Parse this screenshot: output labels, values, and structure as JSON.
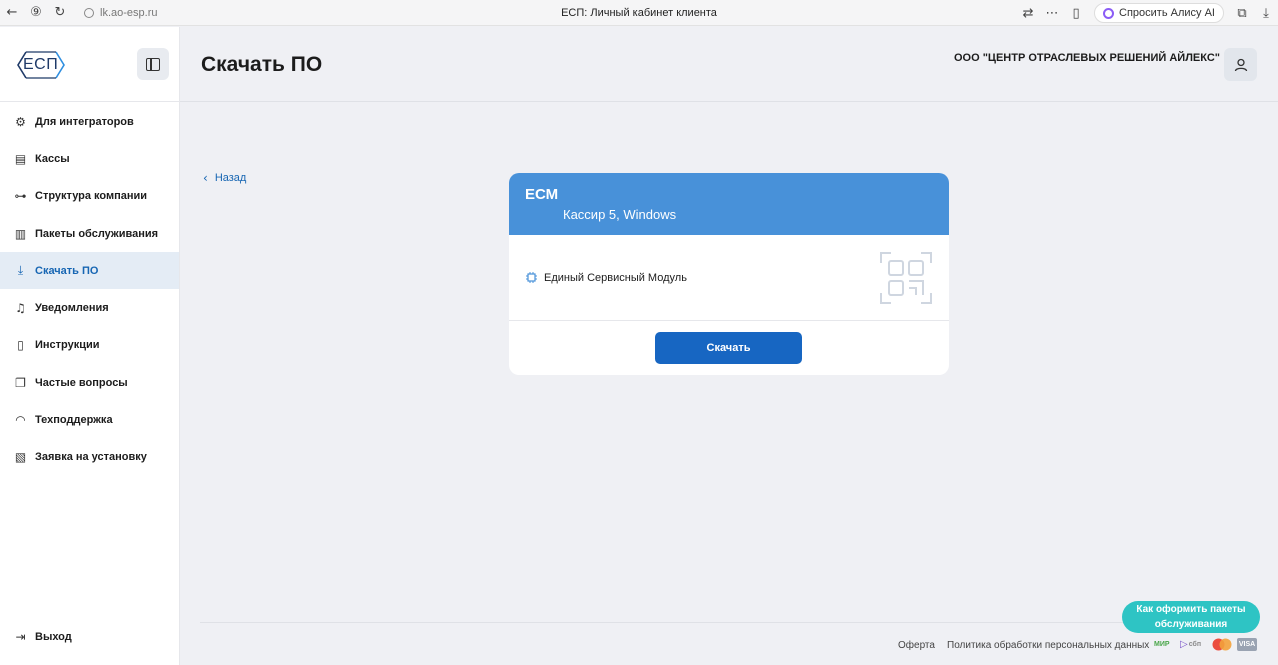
{
  "browser": {
    "url": "lk.ao-esp.ru",
    "tab_title": "ЕСП: Личный кабинет клиента",
    "alice_label": "Спросить Алису AI"
  },
  "sidebar": {
    "logo_text": "ЕСП",
    "items": [
      {
        "label": "Для интеграторов",
        "icon": "puzzle-icon",
        "active": false
      },
      {
        "label": "Кассы",
        "icon": "register-icon",
        "active": false
      },
      {
        "label": "Структура компании",
        "icon": "org-structure-icon",
        "active": false
      },
      {
        "label": "Пакеты обслуживания",
        "icon": "package-icon",
        "active": false
      },
      {
        "label": "Скачать ПО",
        "icon": "download-icon",
        "active": true
      },
      {
        "label": "Уведомления",
        "icon": "bell-icon",
        "active": false
      },
      {
        "label": "Инструкции",
        "icon": "book-icon",
        "active": false
      },
      {
        "label": "Частые вопросы",
        "icon": "faq-icon",
        "active": false
      },
      {
        "label": "Техподдержка",
        "icon": "headset-icon",
        "active": false
      },
      {
        "label": "Заявка на установку",
        "icon": "request-icon",
        "active": false
      }
    ],
    "logout_label": "Выход"
  },
  "header": {
    "title": "Скачать ПО",
    "company": "ООО \"ЦЕНТР ОТРАСЛЕВЫХ РЕШЕНИЙ АЙЛЕКС\""
  },
  "back_label": "Назад",
  "card": {
    "title": "ЕСМ",
    "subtitle": "Кассир 5, Windows",
    "module_label": "Единый Сервисный Модуль",
    "download_label": "Скачать"
  },
  "footer": {
    "offer_label": "Оферта",
    "privacy_label": "Политика обработки персональных данных",
    "payment_mir": "МИР",
    "payment_sbp": "сбп",
    "payment_visa": "VISA"
  },
  "help_button_label": "Как оформить пакеты обслуживания",
  "colors": {
    "accent": "#1766c2",
    "card_header": "#4891d9",
    "help_button": "#2ec4c4",
    "active_nav_bg": "#e4ecf5"
  }
}
